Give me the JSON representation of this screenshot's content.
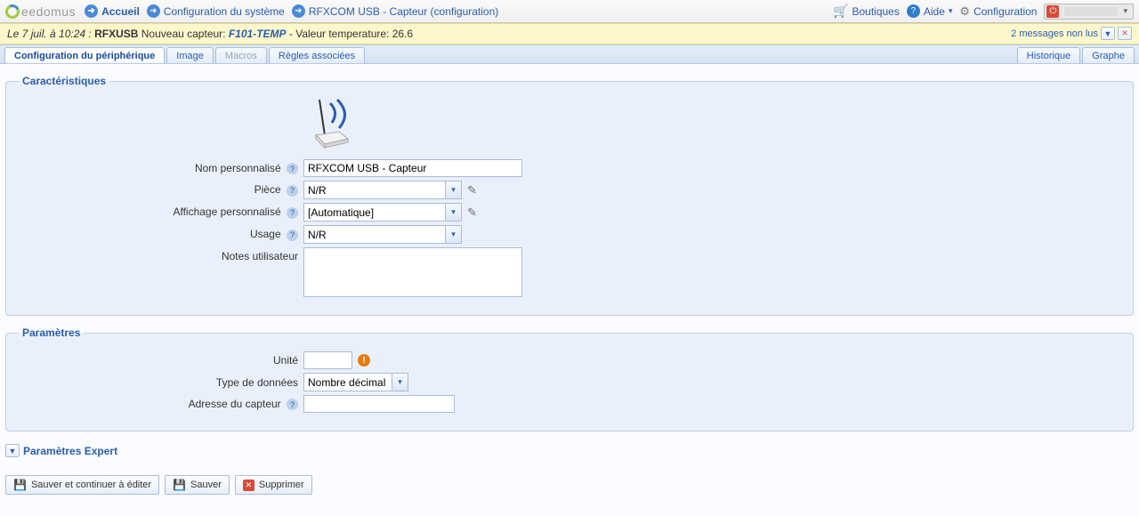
{
  "top": {
    "logo_text": "eedomus",
    "home": "Accueil",
    "sysconf": "Configuration du système",
    "device": "RFXCOM USB - Capteur (configuration)",
    "boutiques": "Boutiques",
    "aide": "Aide",
    "configuration": "Configuration"
  },
  "notif": {
    "date": "Le 7 juil. à 10:24 :",
    "rfx": "RFXUSB",
    "msg1": "Nouveau capteur:",
    "sensor": "F101-TEMP",
    "msg2": "- Valeur temperature: 26.6",
    "unread": "2 messages non lus"
  },
  "tabs": {
    "conf": "Configuration du périphérique",
    "image": "Image",
    "macros": "Macros",
    "rules": "Règles associées",
    "hist": "Historique",
    "graph": "Graphe"
  },
  "carac": {
    "legend": "Caractéristiques",
    "name_label": "Nom personnalisé",
    "name_value": "RFXCOM USB - Capteur",
    "piece_label": "Pièce",
    "piece_value": "N/R",
    "aff_label": "Affichage personnalisé",
    "aff_value": "[Automatique]",
    "usage_label": "Usage",
    "usage_value": "N/R",
    "notes_label": "Notes utilisateur",
    "notes_value": ""
  },
  "param": {
    "legend": "Paramètres",
    "unit_label": "Unité",
    "unit_value": "",
    "type_label": "Type de données",
    "type_value": "Nombre décimal",
    "addr_label": "Adresse du capteur",
    "addr_value": ""
  },
  "expert": {
    "label": "Paramètres Expert"
  },
  "actions": {
    "save_continue": "Sauver et continuer à éditer",
    "save": "Sauver",
    "delete": "Supprimer"
  }
}
